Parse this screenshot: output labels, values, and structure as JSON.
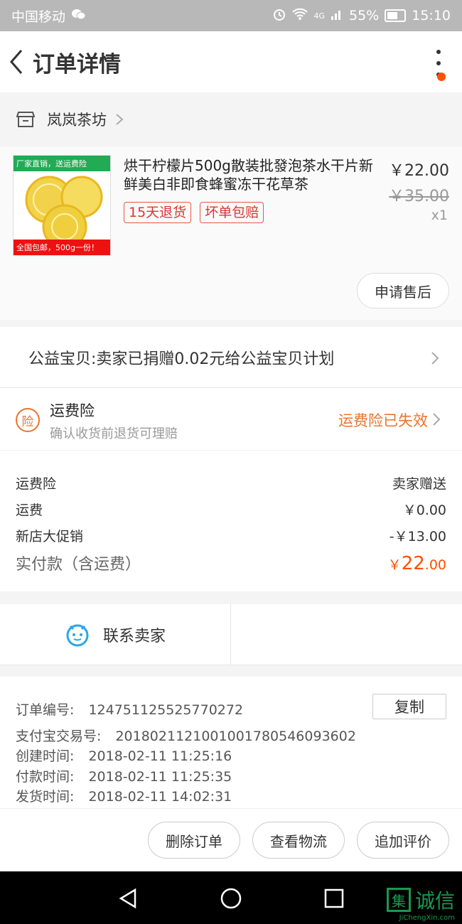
{
  "status_bar": {
    "carrier": "中国移动",
    "network": "4G",
    "battery": "55%",
    "time": "15:10"
  },
  "nav": {
    "title": "订单详情"
  },
  "shop": {
    "name": "岚岚茶坊"
  },
  "product": {
    "image_tag_top": "厂家直销，送运费险",
    "image_tag_bottom": "全国包邮，500g一份！",
    "title": "烘干柠檬片500g散装批發泡茶水干片新鲜美白非即食蜂蜜冻干花草茶",
    "tags": [
      "15天退货",
      "坏单包赔"
    ],
    "price_now": "￥22.00",
    "price_old": "￥35.00",
    "qty": "x1",
    "after_sale_btn": "申请售后"
  },
  "charity": {
    "text": "公益宝贝:卖家已捐赠0.02元给公益宝贝计划"
  },
  "insurance": {
    "badge": "险",
    "title": "运费险",
    "desc": "确认收货前退货可理赔",
    "status": "运费险已失效"
  },
  "fees": {
    "rows": [
      {
        "label": "运费险",
        "value": "卖家赠送"
      },
      {
        "label": "运费",
        "value": "￥0.00"
      },
      {
        "label": "新店大促销",
        "value": "-￥13.00"
      }
    ],
    "total_label": "实付款（含运费）",
    "total_symbol": "￥",
    "total_int": "22",
    "total_dec": ".00"
  },
  "contact": {
    "label": "联系卖家"
  },
  "order_info": {
    "order_no_label": "订单编号:",
    "order_no": "124751125525770272",
    "copy_btn": "复制",
    "alipay_label": "支付宝交易号:",
    "alipay_no": "2018021121001001780546093602",
    "created_label": "创建时间:",
    "created": "2018-02-11 11:25:16",
    "paid_label": "付款时间:",
    "paid": "2018-02-11 11:25:35",
    "shipped_label": "发货时间:",
    "shipped": "2018-02-11 14:02:31"
  },
  "actions": {
    "delete": "删除订单",
    "logistics": "查看物流",
    "review": "追加评价"
  },
  "watermark": {
    "box": "集",
    "text": "诚信",
    "site": "JiChengXin.com"
  },
  "colors": {
    "accent": "#ff5000",
    "insurance": "#e8742e",
    "contact": "#2aa7e8"
  }
}
